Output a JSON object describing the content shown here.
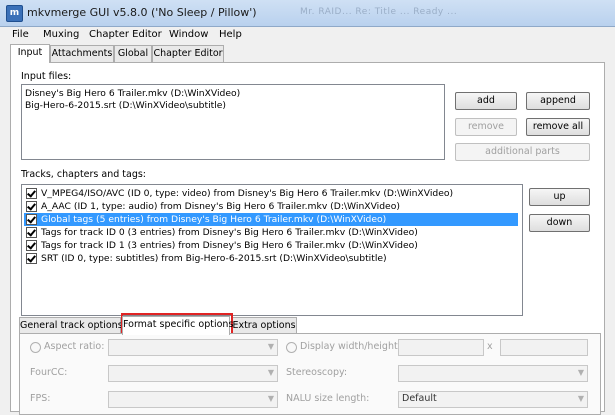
{
  "window": {
    "title": "mkvmerge GUI v5.8.0 ('No Sleep / Pillow')",
    "ghost_text": "Mr. RAID... Re: Title ...   Ready ..."
  },
  "menu": [
    "File",
    "Muxing",
    "Chapter Editor",
    "Window",
    "Help"
  ],
  "tabs": [
    "Input",
    "Attachments",
    "Global",
    "Chapter Editor"
  ],
  "input_files": {
    "label": "Input files:",
    "files": [
      "Disney's Big Hero 6  Trailer.mkv (D:\\WinXVideo)",
      "Big-Hero-6-2015.srt (D:\\WinXVideo\\subtitle)"
    ]
  },
  "file_buttons": {
    "add": "add",
    "append": "append",
    "remove": "remove",
    "remove_all": "remove all",
    "additional_parts": "additional parts"
  },
  "tracks": {
    "label": "Tracks, chapters and tags:",
    "items": [
      "V_MPEG4/ISO/AVC (ID 0, type: video) from Disney's Big Hero 6  Trailer.mkv (D:\\WinXVideo)",
      "A_AAC (ID 1, type: audio) from Disney's Big Hero 6  Trailer.mkv (D:\\WinXVideo)",
      "Global tags (5 entries) from Disney's Big Hero 6  Trailer.mkv (D:\\WinXVideo)",
      "Tags for track ID 0 (3 entries) from Disney's Big Hero 6  Trailer.mkv (D:\\WinXVideo)",
      "Tags for track ID 1 (3 entries) from Disney's Big Hero 6  Trailer.mkv (D:\\WinXVideo)",
      "SRT (ID 0, type: subtitles) from Big-Hero-6-2015.srt (D:\\WinXVideo\\subtitle)"
    ],
    "selected_index": 2
  },
  "track_buttons": {
    "up": "up",
    "down": "down"
  },
  "option_tabs": [
    "General track options",
    "Format specific options",
    "Extra options"
  ],
  "format_options": {
    "aspect_ratio": "Aspect ratio:",
    "display_wh": "Display width/height:",
    "x_sep": "x",
    "fourcc": "FourCC:",
    "stereoscopy": "Stereoscopy:",
    "fps": "FPS:",
    "nalu_size_length": "NALU size length:",
    "nalu_value": "Default"
  },
  "colors": {
    "selection": "#3399ff",
    "highlight_box": "#e02424"
  }
}
